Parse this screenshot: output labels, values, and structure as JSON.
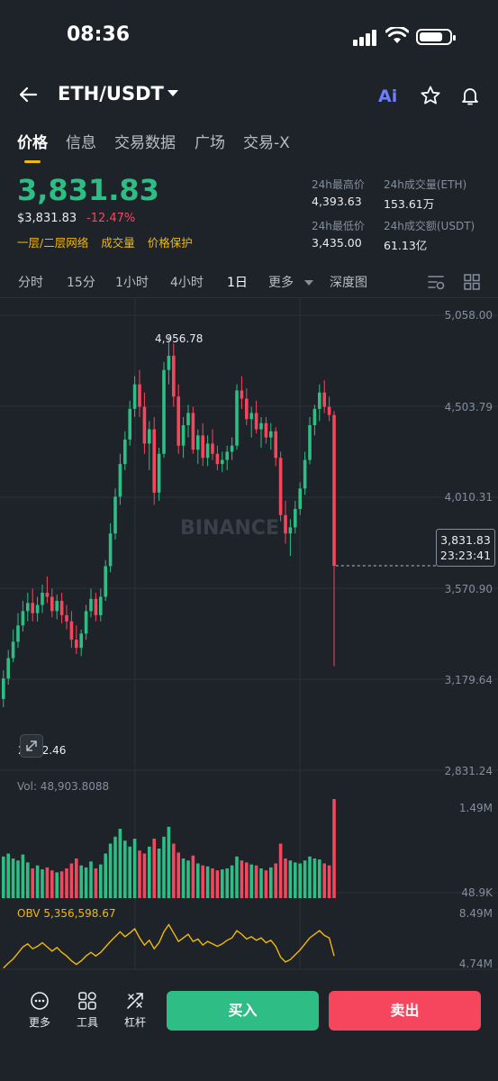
{
  "status_bar": {
    "time": "08:36"
  },
  "header": {
    "pair": "ETH/USDT",
    "ai_label": "Ai"
  },
  "tabs": [
    {
      "label": "价格",
      "active": true
    },
    {
      "label": "信息"
    },
    {
      "label": "交易数据"
    },
    {
      "label": "广场"
    },
    {
      "label": "交易-X"
    }
  ],
  "price": {
    "last": "3,831.83",
    "usd": "$3,831.83",
    "change": "-12.47%",
    "tags": [
      "一层/二层网络",
      "成交量",
      "价格保护"
    ]
  },
  "stats": {
    "high_label": "24h最高价",
    "high": "4,393.63",
    "low_label": "24h最低价",
    "low": "3,435.00",
    "vol_eth_label": "24h成交量(ETH)",
    "vol_eth": "153.61万",
    "vol_usdt_label": "24h成交额(USDT)",
    "vol_usdt": "61.13亿"
  },
  "timeframes": {
    "items": [
      "分时",
      "15分",
      "1小时",
      "4小时",
      "1日",
      "更多",
      "深度图"
    ],
    "active": "1日"
  },
  "chart": {
    "price_axis": [
      "5,058.00",
      "4,503.79",
      "4,010.31",
      "3,570.90",
      "3,179.64",
      "2,831.24"
    ],
    "high_marker": "4,956.78",
    "low_marker": "2,832.46",
    "current_price": "3,831.83",
    "countdown": "23:23:41",
    "watermark": "BINANCE",
    "volume_label": "Vol: 48,903.8088",
    "volume_axis": [
      "1.49M",
      "48.9K"
    ],
    "obv_label": "OBV 5,356,598.67",
    "obv_axis": [
      "8.49M",
      "4.74M"
    ],
    "colors": {
      "up": "#2ebd85",
      "down": "#f6465d",
      "obv": "#f0b90b",
      "accent": "#f0b90b"
    }
  },
  "chart_data": {
    "type": "candlestick",
    "y_range": [
      2831.24,
      5058.0
    ],
    "candles": [
      [
        3180,
        3320,
        3140,
        3280
      ],
      [
        3280,
        3420,
        3250,
        3380
      ],
      [
        3380,
        3520,
        3360,
        3460
      ],
      [
        3460,
        3600,
        3430,
        3540
      ],
      [
        3540,
        3660,
        3510,
        3610
      ],
      [
        3610,
        3700,
        3560,
        3650
      ],
      [
        3650,
        3720,
        3560,
        3600
      ],
      [
        3600,
        3680,
        3560,
        3640
      ],
      [
        3640,
        3740,
        3600,
        3700
      ],
      [
        3700,
        3780,
        3650,
        3680
      ],
      [
        3680,
        3720,
        3580,
        3610
      ],
      [
        3610,
        3690,
        3570,
        3660
      ],
      [
        3660,
        3700,
        3550,
        3590
      ],
      [
        3590,
        3640,
        3520,
        3560
      ],
      [
        3560,
        3610,
        3430,
        3470
      ],
      [
        3470,
        3540,
        3400,
        3430
      ],
      [
        3430,
        3520,
        3390,
        3500
      ],
      [
        3500,
        3640,
        3470,
        3610
      ],
      [
        3610,
        3720,
        3580,
        3670
      ],
      [
        3670,
        3700,
        3560,
        3590
      ],
      [
        3590,
        3720,
        3560,
        3680
      ],
      [
        3680,
        3860,
        3660,
        3830
      ],
      [
        3830,
        4040,
        3800,
        3990
      ],
      [
        3990,
        4210,
        3960,
        4170
      ],
      [
        4170,
        4380,
        4130,
        4330
      ],
      [
        4330,
        4490,
        4300,
        4450
      ],
      [
        4450,
        4640,
        4420,
        4600
      ],
      [
        4600,
        4760,
        4560,
        4720
      ],
      [
        4720,
        4790,
        4560,
        4610
      ],
      [
        4610,
        4680,
        4380,
        4430
      ],
      [
        4430,
        4540,
        4300,
        4500
      ],
      [
        4500,
        4560,
        4130,
        4190
      ],
      [
        4190,
        4410,
        4150,
        4380
      ],
      [
        4380,
        4830,
        4360,
        4790
      ],
      [
        4790,
        4956,
        4720,
        4860
      ],
      [
        4860,
        4920,
        4610,
        4660
      ],
      [
        4660,
        4720,
        4380,
        4420
      ],
      [
        4420,
        4560,
        4360,
        4520
      ],
      [
        4520,
        4620,
        4460,
        4580
      ],
      [
        4580,
        4610,
        4380,
        4400
      ],
      [
        4400,
        4500,
        4330,
        4470
      ],
      [
        4470,
        4530,
        4320,
        4360
      ],
      [
        4360,
        4470,
        4320,
        4430
      ],
      [
        4430,
        4500,
        4350,
        4380
      ],
      [
        4380,
        4420,
        4300,
        4330
      ],
      [
        4330,
        4390,
        4290,
        4350
      ],
      [
        4350,
        4420,
        4300,
        4390
      ],
      [
        4390,
        4460,
        4350,
        4420
      ],
      [
        4420,
        4720,
        4400,
        4690
      ],
      [
        4690,
        4760,
        4600,
        4650
      ],
      [
        4650,
        4700,
        4520,
        4550
      ],
      [
        4550,
        4610,
        4460,
        4580
      ],
      [
        4580,
        4640,
        4480,
        4500
      ],
      [
        4500,
        4560,
        4410,
        4530
      ],
      [
        4530,
        4560,
        4430,
        4460
      ],
      [
        4460,
        4530,
        4400,
        4490
      ],
      [
        4490,
        4510,
        4320,
        4360
      ],
      [
        4360,
        4390,
        4050,
        4080
      ],
      [
        4080,
        4150,
        3940,
        3990
      ],
      [
        3990,
        4060,
        3880,
        4020
      ],
      [
        4020,
        4150,
        3990,
        4110
      ],
      [
        4110,
        4240,
        4080,
        4210
      ],
      [
        4210,
        4390,
        4180,
        4350
      ],
      [
        4350,
        4560,
        4330,
        4520
      ],
      [
        4520,
        4620,
        4470,
        4600
      ],
      [
        4600,
        4720,
        4540,
        4680
      ],
      [
        4680,
        4740,
        4580,
        4610
      ],
      [
        4610,
        4660,
        4540,
        4570
      ],
      [
        4570,
        4590,
        3340,
        3832
      ]
    ],
    "volume": [
      0.42,
      0.45,
      0.4,
      0.38,
      0.44,
      0.36,
      0.3,
      0.33,
      0.29,
      0.31,
      0.28,
      0.26,
      0.27,
      0.3,
      0.35,
      0.4,
      0.33,
      0.31,
      0.37,
      0.3,
      0.34,
      0.45,
      0.55,
      0.62,
      0.7,
      0.58,
      0.52,
      0.6,
      0.48,
      0.45,
      0.52,
      0.6,
      0.5,
      0.62,
      0.72,
      0.55,
      0.46,
      0.4,
      0.38,
      0.43,
      0.35,
      0.33,
      0.32,
      0.3,
      0.28,
      0.29,
      0.3,
      0.33,
      0.42,
      0.38,
      0.36,
      0.34,
      0.33,
      0.3,
      0.28,
      0.31,
      0.35,
      0.55,
      0.4,
      0.38,
      0.36,
      0.35,
      0.38,
      0.42,
      0.4,
      0.39,
      0.35,
      0.33,
      1.0
    ],
    "obv": [
      0.2,
      0.28,
      0.35,
      0.45,
      0.55,
      0.6,
      0.52,
      0.56,
      0.62,
      0.55,
      0.48,
      0.54,
      0.46,
      0.4,
      0.32,
      0.26,
      0.32,
      0.4,
      0.46,
      0.4,
      0.46,
      0.55,
      0.64,
      0.72,
      0.8,
      0.72,
      0.78,
      0.85,
      0.7,
      0.58,
      0.66,
      0.52,
      0.62,
      0.8,
      0.92,
      0.78,
      0.64,
      0.7,
      0.76,
      0.64,
      0.68,
      0.58,
      0.64,
      0.6,
      0.56,
      0.6,
      0.66,
      0.7,
      0.82,
      0.76,
      0.68,
      0.72,
      0.66,
      0.7,
      0.62,
      0.66,
      0.56,
      0.38,
      0.3,
      0.34,
      0.42,
      0.5,
      0.6,
      0.7,
      0.76,
      0.82,
      0.74,
      0.7,
      0.4
    ]
  },
  "bottom_bar": {
    "more": "更多",
    "tools": "工具",
    "leverage": "杠杆",
    "buy": "买入",
    "sell": "卖出"
  }
}
